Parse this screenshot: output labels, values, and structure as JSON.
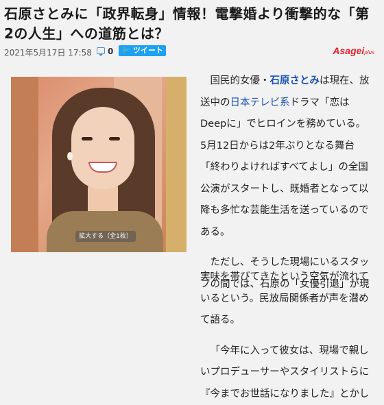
{
  "article": {
    "headline": "石原さとみに「政界転身」情報！電撃婚より衝撃的な「第2の人生」への道筋とは？",
    "date": "2021年5月17日 17:58",
    "comment_count": "0",
    "tweet_label": "ツイート",
    "brand": "Asagei",
    "brand_suffix": "plus",
    "photo_caption": "拡大する（全1枚）",
    "p1": {
      "a": "国民的女優・",
      "name": "石原さとみ",
      "b": "は現在、放送中の",
      "network": "日本テレビ系",
      "c": "ドラマ「",
      "drama": "恋はDeepに",
      "d": "」でヒロインを務めている。5月12日からは2年ぶりとなる舞台「終わりよければすべてよし」の全国公演がスタートし、既婚者となって以降も多忙な芸能生活を送っているのである。"
    },
    "p2_part1": "ただし、そうした現場にいるスタッフの間では、石原の「女優引退」が現",
    "p2_part2": "実味を帯びてきたという空気が流れているという。民放局関係者が声を潜めて語る。",
    "p3": "「今年に入って彼女は、現場で親しいプロデューサーやスタイリストらに『今までお世話になりました』とかし"
  },
  "colors": {
    "link": "#1c53b5",
    "tweet": "#1da1f2",
    "brand": "#e0202a"
  },
  "icons": [
    "comment-icon",
    "twitter-bird-icon"
  ]
}
